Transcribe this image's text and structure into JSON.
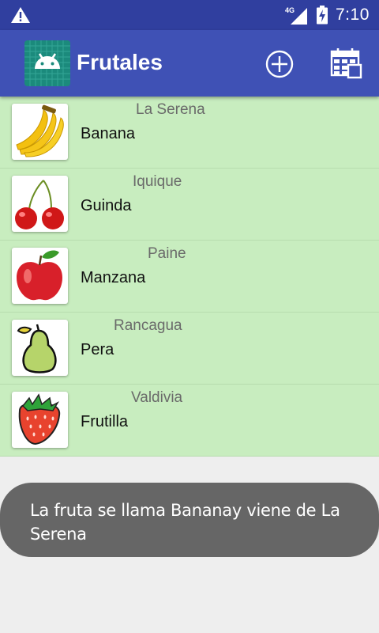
{
  "status_bar": {
    "time": "7:10",
    "network": "4G",
    "icons": [
      "warning-icon",
      "signal-icon",
      "battery-charging-icon"
    ]
  },
  "app_bar": {
    "title": "Frutales",
    "actions": [
      "add-circle-icon",
      "calendar-icon"
    ]
  },
  "list": {
    "items": [
      {
        "city": "La Serena",
        "fruit": "Banana",
        "icon": "banana-icon"
      },
      {
        "city": "Iquique",
        "fruit": "Guinda",
        "icon": "cherry-icon"
      },
      {
        "city": "Paine",
        "fruit": "Manzana",
        "icon": "apple-icon"
      },
      {
        "city": "Rancagua",
        "fruit": "Pera",
        "icon": "pear-icon"
      },
      {
        "city": "Valdivia",
        "fruit": "Frutilla",
        "icon": "strawberry-icon"
      }
    ]
  },
  "toast": {
    "message": "La fruta se llama Bananay viene de La Serena"
  },
  "colors": {
    "status_bar": "#303f9f",
    "app_bar": "#3f51b5",
    "list_background": "#c8edbf",
    "toast_background": "#666666"
  }
}
